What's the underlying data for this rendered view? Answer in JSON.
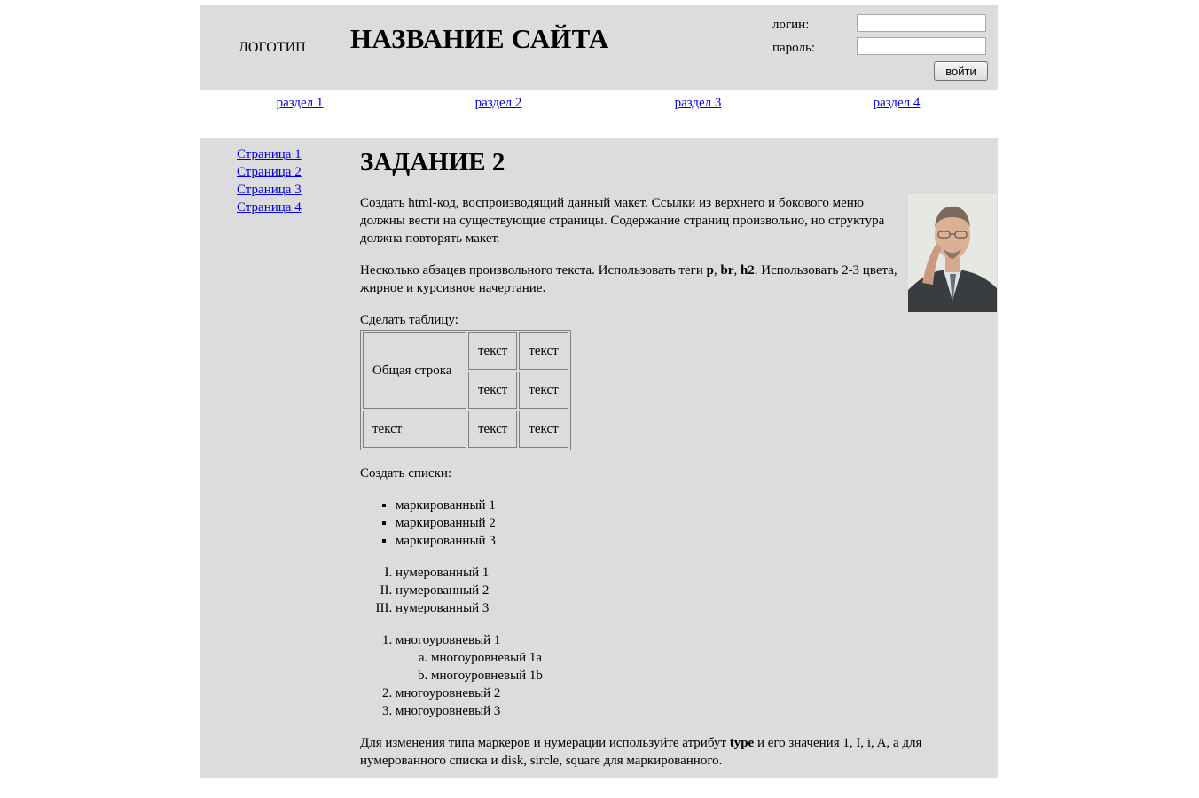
{
  "header": {
    "logo": "ЛОГОТИП",
    "site_title": "НАЗВАНИЕ САЙТА",
    "login_label": "логин:",
    "password_label": "пароль:",
    "login_value": "",
    "password_value": "",
    "submit_label": "войти"
  },
  "topnav": [
    "раздел 1",
    "раздел 2",
    "раздел 3",
    "раздел 4"
  ],
  "sidenav": [
    "Страница 1",
    "Страница 2",
    "Страница 3",
    "Страница 4"
  ],
  "content": {
    "heading": "ЗАДАНИЕ 2",
    "p1": "Создать html-код, воспроизводящий данный макет. Ссылки из верхнего и бокового меню должны вести на существующие страницы. Содержание страниц произвольно, но структура должна повторять макет.",
    "p2": {
      "pre": "Несколько абзацев произвольного текста. Использовать теги ",
      "t1": "p",
      "sep1": ", ",
      "t2": "br",
      "sep2": ", ",
      "t3": "h2",
      "post": ". Использовать 2-3 цвета, жирное и курсивное начертание."
    },
    "table_caption": "Сделать таблицу:",
    "table": {
      "merged": "Общая строка",
      "cells": [
        "текст",
        "текст",
        "текст",
        "текст",
        "текст",
        "текст",
        "текст"
      ]
    },
    "lists_caption": "Создать списки:",
    "bulleted": [
      "маркированный 1",
      "маркированный 2",
      "маркированный 3"
    ],
    "numbered": [
      "нумерованный 1",
      "нумерованный 2",
      "нумерованный 3"
    ],
    "multilevel": {
      "item1": "многоуровневый 1",
      "sub": [
        "многоуровневый 1a",
        "многоуровневый 1b"
      ],
      "item2": "многоуровневый 2",
      "item3": "многоуровневый 3"
    },
    "footer": {
      "pre": "Для изменения типа маркеров и нумерации используйте атрибут ",
      "bold": "type",
      "post": " и его значения 1, I, i, A, а для нумерованного списка и disk, sircle, square для маркированного."
    }
  }
}
